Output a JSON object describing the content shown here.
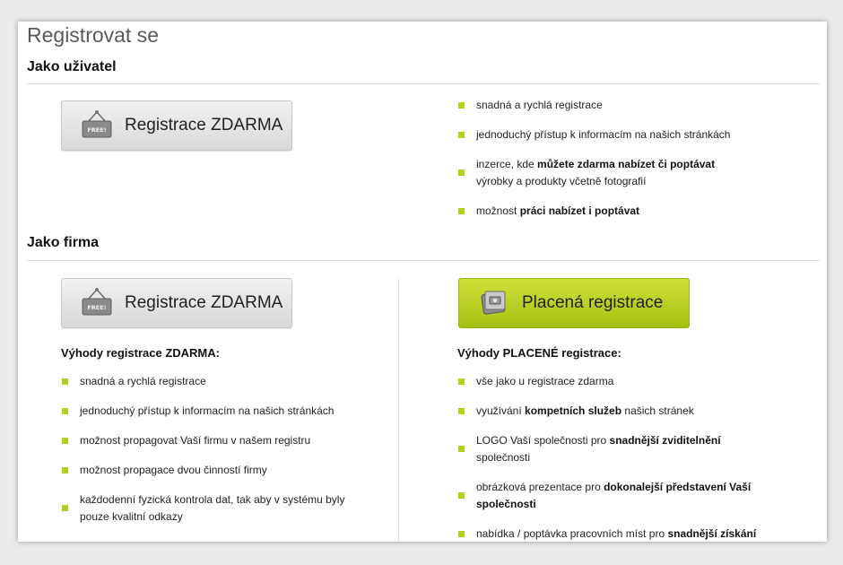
{
  "page_title": "Registrovat se",
  "user_section": {
    "heading": "Jako uživatel",
    "button_label": "Registrace ZDARMA",
    "benefits": [
      [
        {
          "t": "snadná a rychlá registrace",
          "b": false
        }
      ],
      [
        {
          "t": "jednoduchý přístup k informacím na našich stránkách",
          "b": false
        }
      ],
      [
        {
          "t": "inzerce, kde ",
          "b": false
        },
        {
          "t": "můžete zdarma nabízet či poptávat",
          "b": true
        },
        {
          "t": "\nvýrobky a produkty včetně fotografií",
          "b": false
        }
      ],
      [
        {
          "t": "možnost ",
          "b": false
        },
        {
          "t": "práci nabízet i poptávat",
          "b": true
        }
      ]
    ]
  },
  "company_section": {
    "heading": "Jako firma",
    "free": {
      "button_label": "Registrace ZDARMA",
      "subheading": "Výhody registrace ZDARMA:",
      "benefits": [
        [
          {
            "t": "snadná a rychlá registrace",
            "b": false
          }
        ],
        [
          {
            "t": "jednoduchý přístup k informacím na našich stránkách",
            "b": false
          }
        ],
        [
          {
            "t": "možnost propagovat Vaší firmu v našem registru",
            "b": false
          }
        ],
        [
          {
            "t": "možnost propagace dvou činností firmy",
            "b": false
          }
        ],
        [
          {
            "t": "každodenní fyzická kontrola dat, tak aby v systému byly\npouze kvalitní odkazy",
            "b": false
          }
        ]
      ]
    },
    "paid": {
      "button_label": "Placená registrace",
      "subheading": "Výhody PLACENÉ registrace:",
      "benefits": [
        [
          {
            "t": "vše jako u registrace zdarma",
            "b": false
          }
        ],
        [
          {
            "t": "využívání ",
            "b": false
          },
          {
            "t": "kompetních služeb",
            "b": true
          },
          {
            "t": " našich stránek",
            "b": false
          }
        ],
        [
          {
            "t": "LOGO Vaší společnosti pro ",
            "b": false
          },
          {
            "t": "snadnější zviditelnění",
            "b": true
          },
          {
            "t": "\nspolečnosti",
            "b": false
          }
        ],
        [
          {
            "t": "obrázková prezentace pro ",
            "b": false
          },
          {
            "t": "dokonalejší představení Vaší\nspolečnosti",
            "b": true
          }
        ],
        [
          {
            "t": "nabídka / poptávka pracovních míst pro ",
            "b": false
          },
          {
            "t": "snadnější získání",
            "b": true
          }
        ]
      ]
    }
  },
  "icons": {
    "free_tag": "free-tag-icon",
    "wallet": "wallet-icon"
  },
  "colors": {
    "bullet": "#b6cf1f",
    "paid_button": "#b4cc1c",
    "title": "#5a5a5a"
  },
  "free_tag_text": "FREE!"
}
